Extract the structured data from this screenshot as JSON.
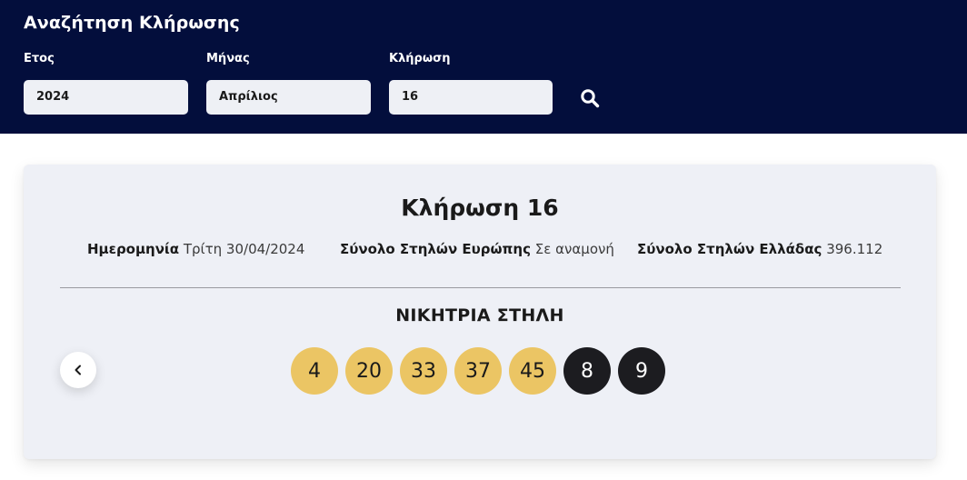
{
  "search": {
    "title": "Αναζήτηση Κλήρωσης",
    "year_label": "Ετος",
    "year_value": "2024",
    "month_label": "Μήνας",
    "month_value": "Απρίλιος",
    "draw_label": "Κλήρωση",
    "draw_value": "16",
    "search_icon": "search-icon"
  },
  "result": {
    "title": "Κλήρωση 16",
    "date_label": "Ημερομηνία",
    "date_value": "Τρίτη 30/04/2024",
    "europe_label": "Σύνολο Στηλών Ευρώπης",
    "europe_value": "Σε αναμονή",
    "greece_label": "Σύνολο Στηλών Ελλάδας",
    "greece_value": "396.112",
    "winning_title": "ΝΙΚΗΤΡΙΑ ΣΤΗΛΗ",
    "prev_icon": "chevron-left-icon",
    "main_numbers": [
      "4",
      "20",
      "33",
      "37",
      "45"
    ],
    "bonus_numbers": [
      "8",
      "9"
    ]
  },
  "colors": {
    "header_bg": "#030e3c",
    "main_ball": "#ebc564",
    "bonus_ball": "#1c1c20",
    "card_bg": "#eef0f6"
  }
}
